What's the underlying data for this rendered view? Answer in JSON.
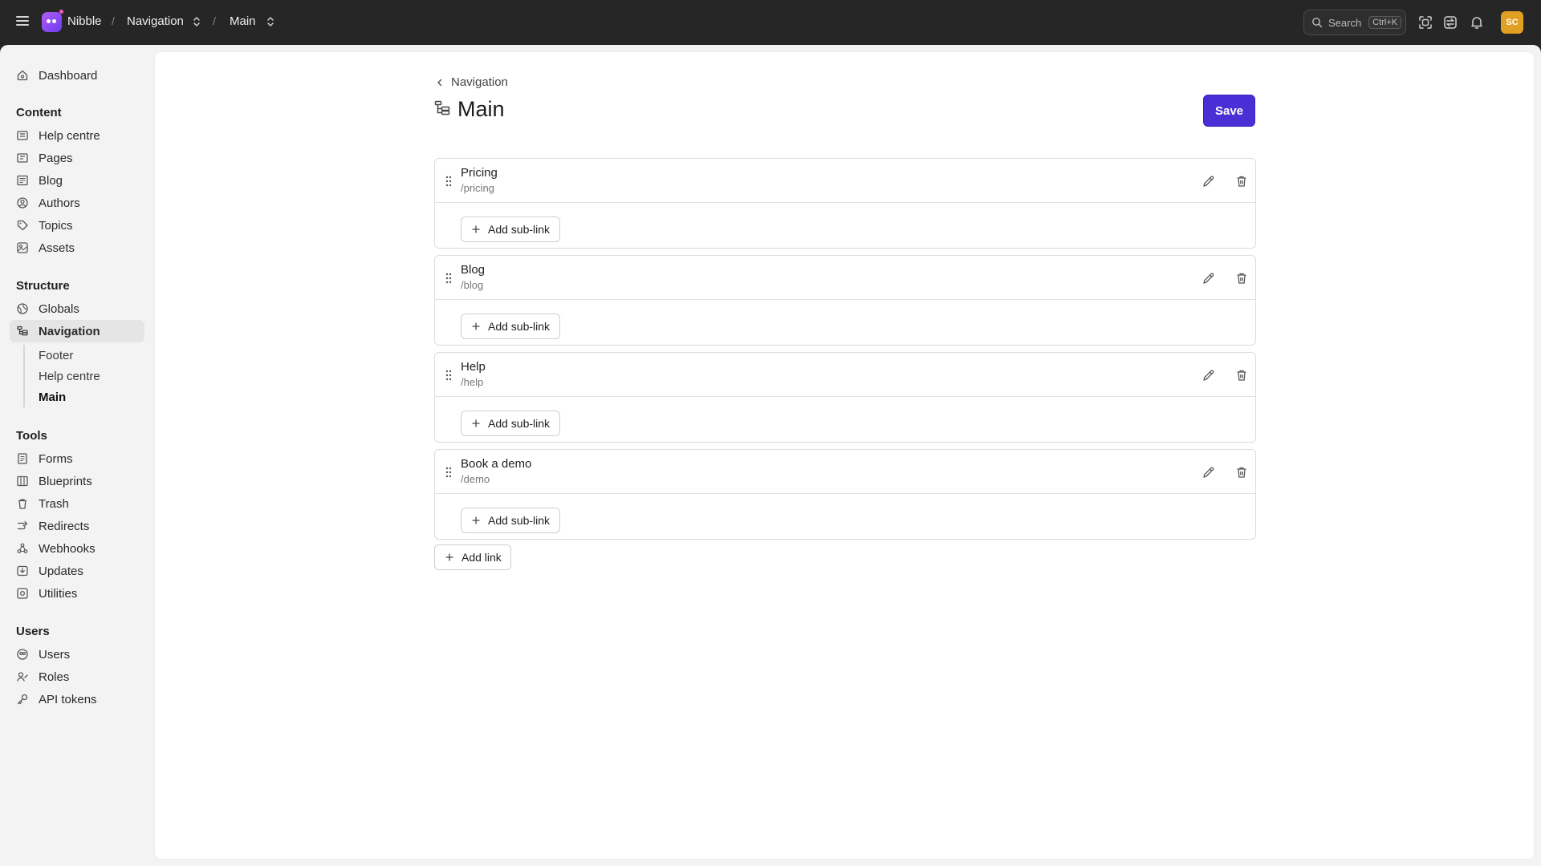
{
  "topbar": {
    "brand": "Nibble",
    "crumb_section": "Navigation",
    "crumb_item": "Main",
    "separator": "/",
    "search_placeholder": "Search",
    "search_shortcut": "Ctrl+K",
    "avatar_initials": "SC"
  },
  "sidebar": {
    "dashboard": "Dashboard",
    "groups": [
      {
        "title": "Content",
        "items": [
          "Help centre",
          "Pages",
          "Blog",
          "Authors",
          "Topics",
          "Assets"
        ]
      },
      {
        "title": "Structure",
        "items": [
          "Globals",
          "Navigation"
        ]
      },
      {
        "title": "Tools",
        "items": [
          "Forms",
          "Blueprints",
          "Trash",
          "Redirects",
          "Webhooks",
          "Updates",
          "Utilities"
        ]
      },
      {
        "title": "Users",
        "items": [
          "Users",
          "Roles",
          "API tokens"
        ]
      }
    ],
    "navigation_children": [
      "Footer",
      "Help centre",
      "Main"
    ]
  },
  "page": {
    "back_label": "Navigation",
    "title": "Main",
    "save_label": "Save",
    "add_sublink_label": "Add sub-link",
    "add_link_label": "Add link",
    "links": [
      {
        "name": "Pricing",
        "url": "/pricing"
      },
      {
        "name": "Blog",
        "url": "/blog"
      },
      {
        "name": "Help",
        "url": "/help"
      },
      {
        "name": "Book a demo",
        "url": "/demo"
      }
    ]
  },
  "colors": {
    "topbar_bg": "#262626",
    "accent": "#4a2fd6",
    "avatar": "#e2a023",
    "sidebar_bg": "#f3f3f3",
    "panel_bg": "#ffffff"
  }
}
